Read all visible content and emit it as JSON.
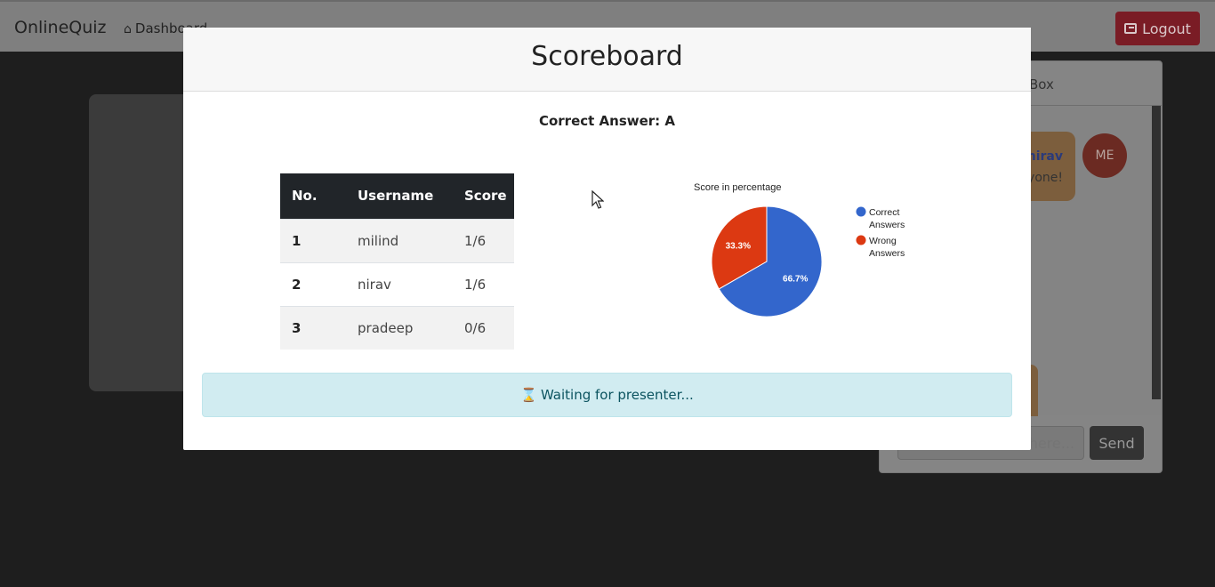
{
  "navbar": {
    "brand": "OnlineQuiz",
    "dashboard_label": "Dashboard",
    "logout_label": "Logout"
  },
  "chat": {
    "title": "Box",
    "messages": [
      {
        "name": "nirav",
        "text": "yone!"
      }
    ],
    "avatar_label": "ME",
    "input_placeholder": "here...",
    "send_label": "Send"
  },
  "modal": {
    "title": "Scoreboard",
    "correct_answer": "Correct Answer: A",
    "table": {
      "headers": [
        "No.",
        "Username",
        "Score"
      ],
      "rows": [
        {
          "no": "1",
          "username": "milind",
          "score": "1/6"
        },
        {
          "no": "2",
          "username": "nirav",
          "score": "1/6"
        },
        {
          "no": "3",
          "username": "pradeep",
          "score": "0/6"
        }
      ]
    },
    "waiting_text": "Waiting for presenter..."
  },
  "chart_data": {
    "type": "pie",
    "title": "Score in percentage",
    "categories": [
      "Correct Answers",
      "Wrong Answers"
    ],
    "values": [
      66.7,
      33.3
    ],
    "labels": [
      "66.7%",
      "33.3%"
    ],
    "colors": [
      "#3366cc",
      "#dc3912"
    ],
    "legend": "right"
  }
}
